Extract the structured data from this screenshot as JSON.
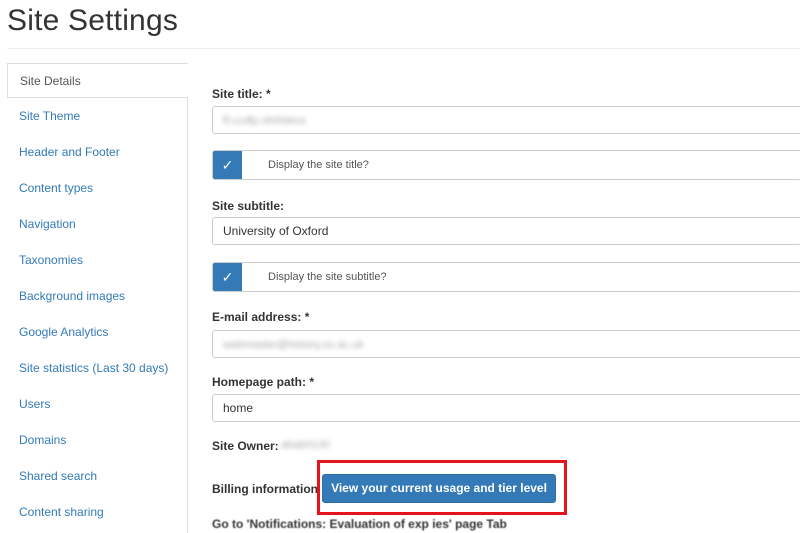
{
  "page": {
    "title": "Site Settings"
  },
  "sidebar": {
    "items": [
      {
        "label": "Site Details"
      },
      {
        "label": "Site Theme"
      },
      {
        "label": "Header and Footer"
      },
      {
        "label": "Content types"
      },
      {
        "label": "Navigation"
      },
      {
        "label": "Taxonomies"
      },
      {
        "label": "Background images"
      },
      {
        "label": "Google Analytics"
      },
      {
        "label": "Site statistics (Last 30 days)"
      },
      {
        "label": "Users"
      },
      {
        "label": "Domains"
      },
      {
        "label": "Shared search"
      },
      {
        "label": "Content sharing"
      }
    ]
  },
  "form": {
    "site_title_label": "Site title: *",
    "site_title_value": "ff.ccdfp.ofrthbkss",
    "display_title_label": "Display the site title?",
    "display_title_checked": true,
    "site_subtitle_label": "Site subtitle:",
    "site_subtitle_value": "University of Oxford",
    "display_subtitle_label": "Display the site subtitle?",
    "display_subtitle_checked": true,
    "email_label": "E-mail address: *",
    "email_value": "webmaster@history.ox.ac.uk",
    "homepage_label": "Homepage path: *",
    "homepage_value": "home",
    "owner_label": "Site Owner:",
    "owner_value": "abab0130",
    "billing_label": "Billing information",
    "billing_button": "View your current usage and tier level",
    "next_section_cutoff": "Go to 'Notifications: Evaluation of exp ies' page Tab"
  },
  "colors": {
    "primary": "#337ab7",
    "highlight": "#e3141b"
  }
}
